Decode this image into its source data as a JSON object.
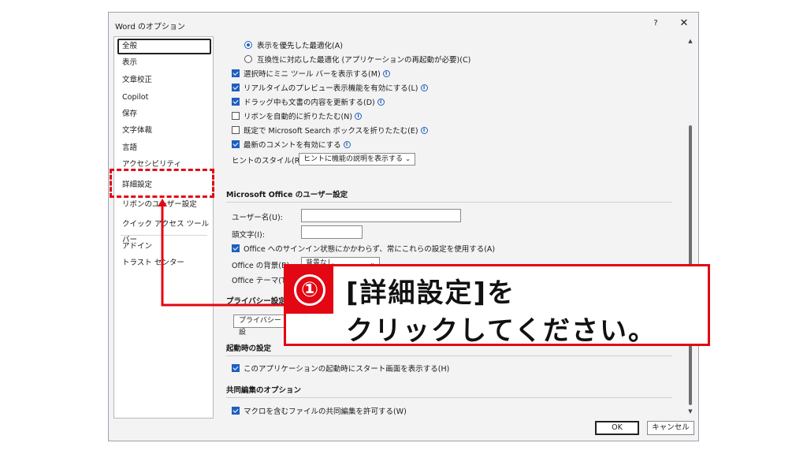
{
  "window": {
    "title": "Word のオプション",
    "help": "?",
    "close": "✕"
  },
  "nav": {
    "items": [
      {
        "label": "全般"
      },
      {
        "label": "表示"
      },
      {
        "label": "文章校正"
      },
      {
        "label": "Copilot"
      },
      {
        "label": "保存"
      },
      {
        "label": "文字体裁"
      },
      {
        "label": "言語"
      },
      {
        "label": "アクセシビリティ"
      },
      {
        "label": "詳細設定"
      },
      {
        "label": "リボンのユーザー設定"
      },
      {
        "label": "クイック アクセス ツール バー"
      },
      {
        "label": "アドイン"
      },
      {
        "label": "トラスト センター"
      }
    ],
    "selected": "全般"
  },
  "ui_options": {
    "radio_display": "表示を優先した最適化(A)",
    "radio_compat": "互換性に対応した最適化 (アプリケーションの再起動が必要)(C)",
    "mini_toolbar": "選択時にミニ ツール バーを表示する(M)",
    "live_preview": "リアルタイムのプレビュー表示機能を有効にする(L)",
    "drag_update": "ドラッグ中も文書の内容を更新する(D)",
    "collapse_ribbon": "リボンを自動的に折りたたむ(N)",
    "collapse_search": "既定で Microsoft Search ボックスを折りたたむ(E)",
    "modern_comments": "最新のコメントを有効にする",
    "tooltip_label": "ヒントのスタイル(R):",
    "tooltip_value": "ヒントに機能の説明を表示する"
  },
  "personalize": {
    "title": "Microsoft Office のユーザー設定",
    "username_label": "ユーザー名(U):",
    "username_value": "",
    "initials_label": "頭文字(I):",
    "initials_value": "",
    "always_use": "Office へのサインイン状態にかかわらず、常にこれらの設定を使用する(A)",
    "background_label": "Office の背景(B):",
    "background_value": "背景なし",
    "theme_label": "Office テーマ(T):"
  },
  "privacy": {
    "title": "プライバシー設定",
    "button": "プライバシー設"
  },
  "startup": {
    "title": "起動時の設定",
    "show_start": "このアプリケーションの起動時にスタート画面を表示する(H)"
  },
  "coauthoring": {
    "title": "共同編集のオプション",
    "allow_coauthor": "マクロを含むファイルの共同編集を許可する(W)"
  },
  "footer": {
    "ok": "OK",
    "cancel": "キャンセル"
  },
  "callout": {
    "number": "①",
    "line1": "[詳細設定]を",
    "line2": "クリックしてください。"
  },
  "colors": {
    "accent": "#e30613",
    "check": "#1f5fbf"
  }
}
